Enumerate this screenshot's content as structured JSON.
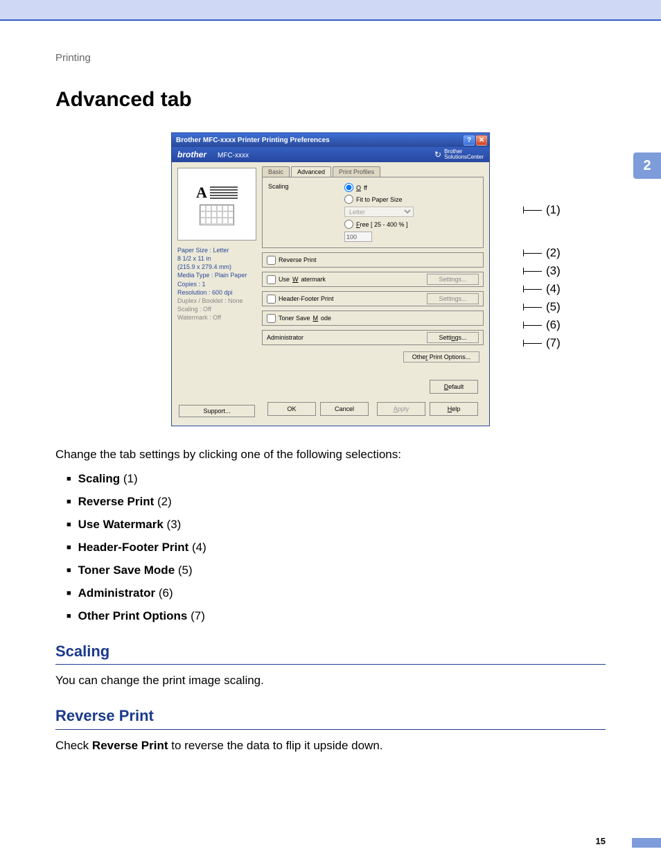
{
  "breadcrumb": "Printing",
  "page_title": "Advanced tab",
  "chapter_marker": "2",
  "page_number": "15",
  "dialog": {
    "title": "Brother MFC-xxxx  Printer Printing Preferences",
    "brand_logo": "brother",
    "model": "MFC-xxxx",
    "solutions_center": "Brother\nSolutionsCenter",
    "tabs": {
      "basic": "Basic",
      "advanced": "Advanced",
      "print_profiles": "Print Profiles"
    },
    "preview": {
      "paper_size": "Paper Size : Letter",
      "dimensions_in": "8 1/2 x 11 in",
      "dimensions_mm": "(215.9 x 279.4 mm)",
      "media_type": "Media Type : Plain Paper",
      "copies": "Copies : 1",
      "resolution": "Resolution : 600 dpi",
      "duplex": "Duplex / Booklet : None",
      "scaling": "Scaling : Off",
      "watermark": "Watermark : Off"
    },
    "support": "Support...",
    "scaling": {
      "label": "Scaling",
      "off": "Off",
      "fit": "Fit to Paper Size",
      "fit_select": "Letter",
      "free": "Free [ 25 - 400 % ]",
      "free_value": "100"
    },
    "options": {
      "reverse_print": "Reverse Print",
      "use_watermark": "Use Watermark",
      "header_footer": "Header-Footer Print",
      "toner_save": "Toner Save Mode",
      "administrator": "Administrator",
      "settings": "Settings...",
      "other_print_options": "Other Print Options..."
    },
    "default": "Default",
    "buttons": {
      "ok": "OK",
      "cancel": "Cancel",
      "apply": "Apply",
      "help": "Help"
    }
  },
  "callouts": {
    "c1": "(1)",
    "c2": "(2)",
    "c3": "(3)",
    "c4": "(4)",
    "c5": "(5)",
    "c6": "(6)",
    "c7": "(7)"
  },
  "text": {
    "intro": "Change the tab settings by clicking one of the following selections:",
    "li1_b": "Scaling",
    "li1_n": " (1)",
    "li2_b": "Reverse Print",
    "li2_n": " (2)",
    "li3_b": "Use Watermark",
    "li3_n": " (3)",
    "li4_b": "Header-Footer Print",
    "li4_n": " (4)",
    "li5_b": "Toner Save Mode",
    "li5_n": " (5)",
    "li6_b": "Administrator",
    "li6_n": " (6)",
    "li7_b": "Other Print Options",
    "li7_n": " (7)",
    "scaling_h": "Scaling",
    "scaling_p": "You can change the print image scaling.",
    "reverse_h": "Reverse Print",
    "reverse_p1": "Check ",
    "reverse_b": "Reverse Print",
    "reverse_p2": " to reverse the data to flip it upside down."
  }
}
